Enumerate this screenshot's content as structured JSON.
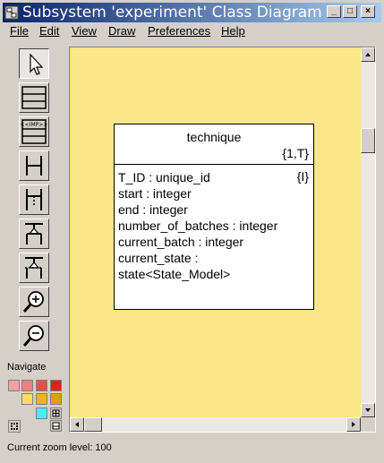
{
  "window": {
    "title": "Subsystem 'experiment' Class Diagram ...",
    "controls": {
      "minimize": "_",
      "maximize": "□",
      "close": "×"
    }
  },
  "menu": [
    {
      "label": "File",
      "mnemonic": "F"
    },
    {
      "label": "Edit",
      "mnemonic": "E"
    },
    {
      "label": "View",
      "mnemonic": "V"
    },
    {
      "label": "Draw",
      "mnemonic": "D"
    },
    {
      "label": "Preferences",
      "mnemonic": "P"
    },
    {
      "label": "Help",
      "mnemonic": "H"
    }
  ],
  "toolbar": {
    "tools": [
      {
        "name": "select-tool",
        "icon": "arrow-pointer-icon",
        "pressed": true
      },
      {
        "name": "class-tool",
        "icon": "class-box-icon"
      },
      {
        "name": "imported-class-tool",
        "icon": "imported-class-icon",
        "text": "<<IMP>>"
      },
      {
        "name": "association-tool",
        "icon": "association-icon"
      },
      {
        "name": "associative-tool",
        "icon": "associative-link-icon"
      },
      {
        "name": "inheritance-tool",
        "icon": "inheritance-icon"
      },
      {
        "name": "inheritance-dashed-tool",
        "icon": "inheritance-dashed-icon"
      },
      {
        "name": "zoom-in-tool",
        "icon": "zoom-in-icon"
      },
      {
        "name": "zoom-out-tool",
        "icon": "zoom-out-icon"
      }
    ]
  },
  "navigate": {
    "label": "Navigate",
    "colors": [
      "#f4a0a0",
      "#f08080",
      "#e05050",
      "#e02020",
      "#ffd966",
      "#f0b020",
      "#e0a000",
      "#40f0ff"
    ]
  },
  "diagram": {
    "class": {
      "name": "technique",
      "key_letters": "{1,T}",
      "identifier_tag": "{I}",
      "attributes": [
        "T_ID : unique_id",
        "start : integer",
        "end : integer",
        "number_of_batches : integer",
        "current_batch : integer",
        "current_state :",
        "state<State_Model>"
      ]
    },
    "canvas_color": "#fbe68a"
  },
  "status": {
    "text": "Current zoom level: 100"
  }
}
